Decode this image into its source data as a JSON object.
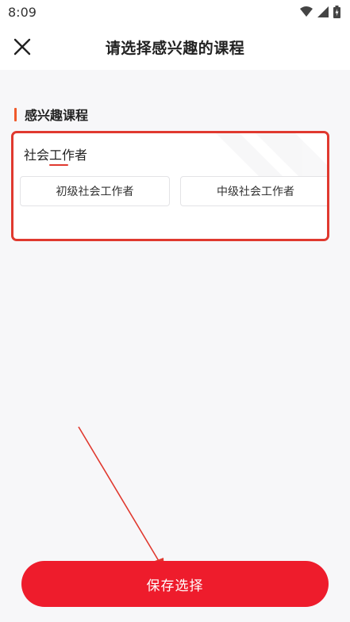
{
  "status_bar": {
    "time": "8:09",
    "icons": [
      "wifi-icon",
      "signal-icon",
      "battery-icon"
    ]
  },
  "header": {
    "title": "请选择感兴趣的课程",
    "close_icon": "close-icon"
  },
  "section": {
    "title": "感兴趣课程"
  },
  "category": {
    "name": "社会工作者",
    "courses": [
      {
        "label": "初级社会工作者"
      },
      {
        "label": "中级社会工作者"
      }
    ]
  },
  "footer": {
    "save_label": "保存选择"
  },
  "colors": {
    "accent": "#ee1c2c",
    "highlight_border": "#e0392f",
    "section_bar": "#f05a2b"
  }
}
